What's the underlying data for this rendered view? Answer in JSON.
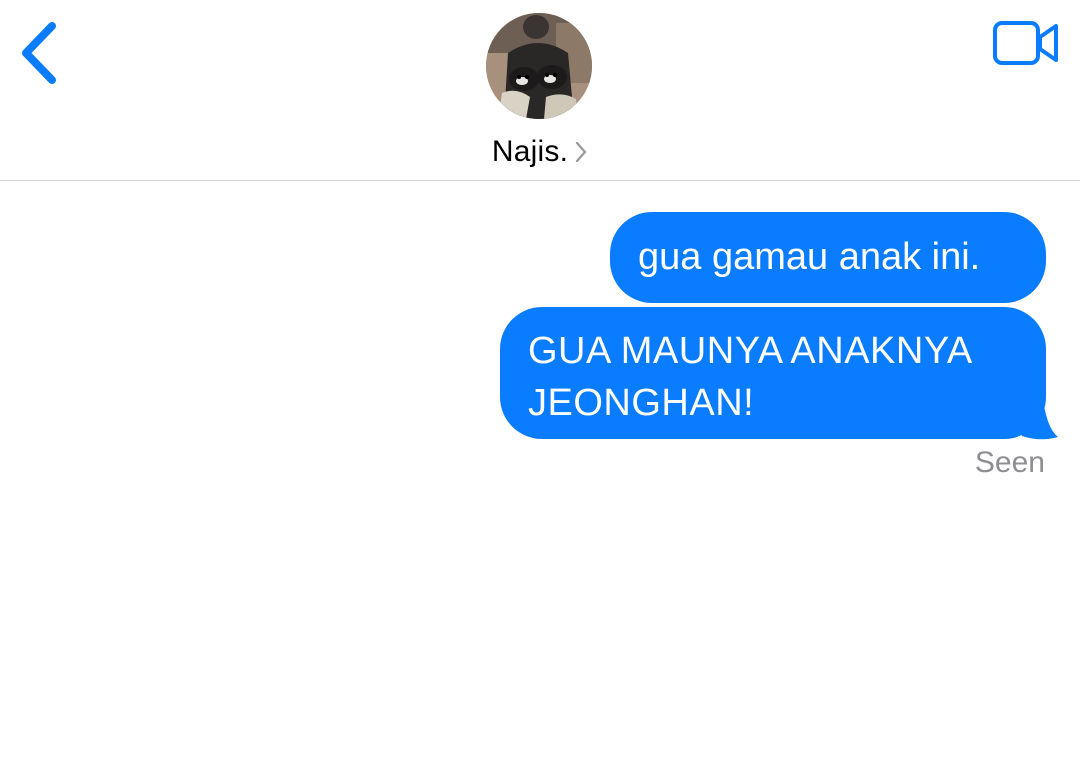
{
  "header": {
    "back_icon": "chevron-left-icon",
    "video_icon": "video-camera-icon",
    "contact": {
      "name": "Najis.",
      "avatar": "contact-photo",
      "detail_icon": "chevron-right-icon"
    }
  },
  "messages": [
    {
      "direction": "outgoing",
      "lines": [
        "gua gamau anak ini."
      ]
    },
    {
      "direction": "outgoing",
      "lines": [
        "GUA MAUNYA ANAKNYA",
        "JEONGHAN!"
      ]
    }
  ],
  "status": "Seen",
  "colors": {
    "accent": "#0a7cff",
    "bubble_text": "#ffffff",
    "status_text": "#8e8e93",
    "divider": "#d6d6d8"
  }
}
